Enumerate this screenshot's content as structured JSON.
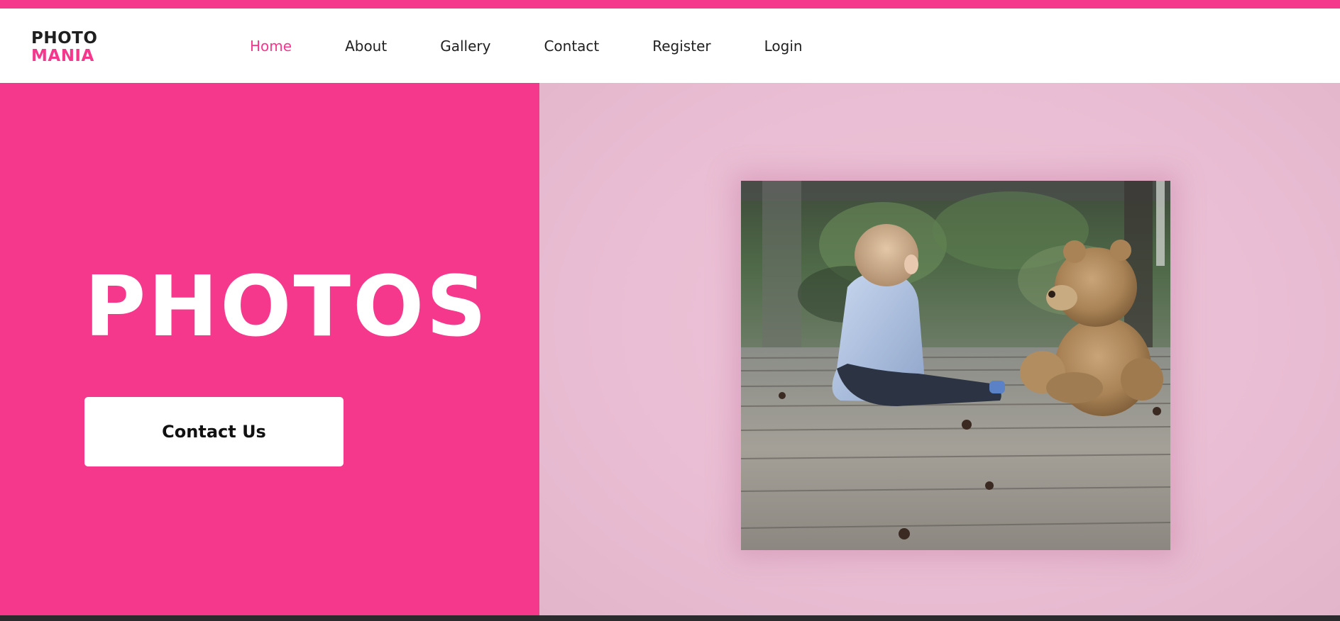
{
  "colors": {
    "accent": "#f5388c",
    "hero_right_bg": "#ebbfd5",
    "text_dark": "#1f1f1f"
  },
  "brand": {
    "line1": "PHOTO",
    "line2": "MANIA"
  },
  "nav": {
    "items": [
      {
        "label": "Home",
        "active": true
      },
      {
        "label": "About"
      },
      {
        "label": "Gallery"
      },
      {
        "label": "Contact"
      },
      {
        "label": "Register"
      },
      {
        "label": "Login"
      }
    ]
  },
  "hero": {
    "title": "PHOTOS",
    "cta_label": "Contact Us"
  },
  "photo": {
    "subject": "child-with-teddy-bear-photo"
  }
}
